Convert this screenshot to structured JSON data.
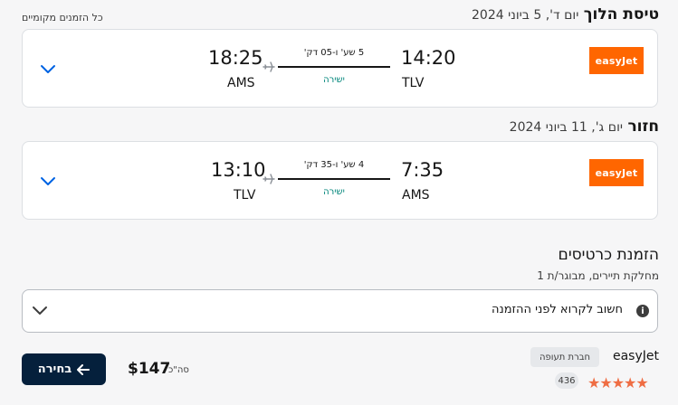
{
  "local_times_note": "כל הזמנים מקומיים",
  "outbound": {
    "label": "טיסת הלוך",
    "date": "יום ד', 5 ביוני 2024",
    "airline_logo": "easyJet",
    "depart_time": "14:20",
    "depart_code": "TLV",
    "arrive_time": "18:25",
    "arrive_code": "AMS",
    "duration": "5 שע' ו-05 דק'",
    "stops": "ישירה"
  },
  "inbound": {
    "label": "חזור",
    "date": "יום ג', 11 ביוני 2024",
    "airline_logo": "easyJet",
    "depart_time": "7:35",
    "depart_code": "AMS",
    "arrive_time": "13:10",
    "arrive_code": "TLV",
    "duration": "4 שע' ו-35 דק'",
    "stops": "ישירה"
  },
  "booking": {
    "title": "הזמנת כרטיסים",
    "subtitle": "מחלקת תיירים, מבוגר/ת 1",
    "notice": "חשוב לקרוא לפני ההזמנה"
  },
  "offer": {
    "airline": "easyJet",
    "badge": "חברת תעופה",
    "rating_stars": 5,
    "reviews_count": "436",
    "price": "$147",
    "total_label": "סה\"כ",
    "select_label": "בחירה"
  },
  "colors": {
    "brand_orange": "#ff6600",
    "primary_button": "#05203c",
    "link_blue": "#0062e3",
    "direct_green": "#00857a",
    "star": "#ef6d43"
  }
}
